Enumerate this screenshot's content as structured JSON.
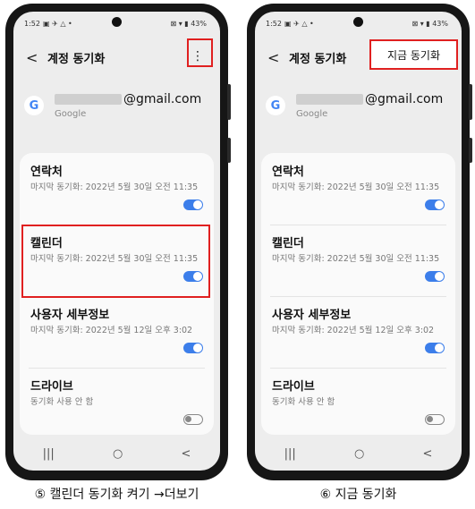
{
  "status_bar": {
    "time": "1:52",
    "indicators_left": "▣ ✈ △ •",
    "indicators_right": "⊠ ▾ ▮ 43%"
  },
  "header": {
    "title": "계정 동기화",
    "back_glyph": "<",
    "more_glyph": "⋮",
    "sync_now_label": "지금 동기화"
  },
  "account": {
    "email_suffix": "@gmail.com",
    "provider": "Google",
    "google_letter": "G"
  },
  "items": [
    {
      "title": "연락처",
      "subtitle": "마지막 동기화: 2022년 5월 30일 오전 11:35",
      "toggle": "on"
    },
    {
      "title": "캘린더",
      "subtitle": "마지막 동기화: 2022년 5월 30일 오전 11:35",
      "toggle": "on"
    },
    {
      "title": "사용자 세부정보",
      "subtitle": "마지막 동기화: 2022년 5월 12일 오후 3:02",
      "toggle": "on"
    },
    {
      "title": "드라이브",
      "subtitle": "동기화 사용 안 함",
      "toggle": "off"
    }
  ],
  "nav": {
    "recents": "|||",
    "home": "○",
    "back": "<"
  },
  "captions": {
    "left": "⑤ 캘린더 동기화 켜기 →더보기",
    "right": "⑥ 지금 동기화"
  },
  "colors": {
    "toggle_on": "#3c7eea",
    "highlight": "#e02020"
  }
}
